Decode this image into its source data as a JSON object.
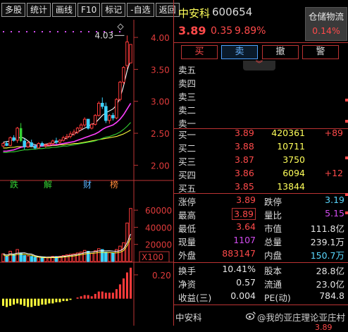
{
  "toolbar": {
    "buttons": [
      "多股",
      "统计",
      "画线",
      "F10",
      "标记",
      "-自选",
      "返回"
    ]
  },
  "stock": {
    "name": "中安科",
    "code": "600654",
    "price": "3.89",
    "change": "0.35",
    "change_pct": "9.89%",
    "sector": "仓储物流",
    "sector_pct": "0.14%"
  },
  "trade_buttons": {
    "buy": "买",
    "sell": "卖",
    "cancel": "撤",
    "alert": "警"
  },
  "collapse_icon": "double-chevron-down-icon",
  "sell_orders": [
    {
      "label": "卖五",
      "price": "",
      "volume": "",
      "change": ""
    },
    {
      "label": "卖四",
      "price": "",
      "volume": "",
      "change": ""
    },
    {
      "label": "卖三",
      "price": "",
      "volume": "",
      "change": ""
    },
    {
      "label": "卖二",
      "price": "",
      "volume": "",
      "change": ""
    },
    {
      "label": "卖一",
      "price": "",
      "volume": "",
      "change": ""
    }
  ],
  "buy_orders": [
    {
      "label": "买一",
      "price": "3.89",
      "volume": "420361",
      "change": "+89"
    },
    {
      "label": "买二",
      "price": "3.88",
      "volume": "10711",
      "change": ""
    },
    {
      "label": "买三",
      "price": "3.87",
      "volume": "3750",
      "change": ""
    },
    {
      "label": "买四",
      "price": "3.86",
      "volume": "6094",
      "change": "+12"
    },
    {
      "label": "买五",
      "price": "3.85",
      "volume": "13844",
      "change": ""
    }
  ],
  "stats1": [
    {
      "l1": "涨停",
      "v1": "3.89",
      "l2": "跌停",
      "v2": "3.19"
    },
    {
      "l1": "最高",
      "v1": "3.89",
      "l2": "量比",
      "v2": "5.15"
    },
    {
      "l1": "最低",
      "v1": "3.64",
      "l2": "市值",
      "v2": "111.8亿"
    },
    {
      "l1": "现量",
      "v1": "1107",
      "l2": "总量",
      "v2": "239.1万"
    },
    {
      "l1": "外盘",
      "v1": "883147",
      "l2": "内盘",
      "v2": "150.7万"
    }
  ],
  "stats2": [
    {
      "l1": "换手",
      "v1": "10.41%",
      "l2": "股本",
      "v2": "28.8亿"
    },
    {
      "l1": "净资",
      "v1": "0.57",
      "l2": "流通",
      "v2": "23.0亿"
    },
    {
      "l1": "收益(三)",
      "v1": "0.004",
      "l2": "PE(动)",
      "v2": "784.8"
    }
  ],
  "bottom": {
    "name": "中安科",
    "watermark": "@我的亚庄理论亚庄村",
    "price": "3.89"
  },
  "chart": {
    "price_ticks": [
      "4.00",
      "3.50",
      "3.00",
      "2.50",
      "2.00"
    ],
    "high_label": "4.03",
    "events": [
      "跌",
      "解",
      "财",
      "榜"
    ],
    "volume_ticks": [
      "60000",
      "40000",
      "20000"
    ],
    "volume_unit": "X100",
    "indicator_tick": "0.20"
  },
  "chart_data": {
    "type": "candlestick",
    "price_ylim": [
      1.85,
      4.1
    ],
    "candles": [
      [
        2.3,
        2.36,
        2.28,
        2.34
      ],
      [
        2.34,
        2.38,
        2.3,
        2.31
      ],
      [
        2.31,
        2.45,
        2.3,
        2.43
      ],
      [
        2.43,
        2.47,
        2.37,
        2.39
      ],
      [
        2.39,
        2.6,
        2.35,
        2.58
      ],
      [
        2.58,
        2.66,
        2.36,
        2.38
      ],
      [
        2.38,
        2.42,
        2.25,
        2.29
      ],
      [
        2.29,
        2.38,
        2.27,
        2.35
      ],
      [
        2.35,
        2.4,
        2.28,
        2.3
      ],
      [
        2.3,
        2.33,
        2.25,
        2.27
      ],
      [
        2.27,
        2.36,
        2.26,
        2.34
      ],
      [
        2.34,
        2.37,
        2.29,
        2.31
      ],
      [
        2.31,
        2.34,
        2.27,
        2.32
      ],
      [
        2.32,
        2.36,
        2.3,
        2.34
      ],
      [
        2.34,
        2.4,
        2.31,
        2.38
      ],
      [
        2.38,
        2.43,
        2.33,
        2.36
      ],
      [
        2.36,
        2.41,
        2.33,
        2.39
      ],
      [
        2.39,
        2.46,
        2.37,
        2.43
      ],
      [
        2.43,
        2.49,
        2.4,
        2.45
      ],
      [
        2.45,
        2.53,
        2.42,
        2.49
      ],
      [
        2.49,
        2.56,
        2.46,
        2.52
      ],
      [
        2.52,
        2.6,
        2.49,
        2.58
      ],
      [
        2.58,
        2.66,
        2.54,
        2.63
      ],
      [
        2.63,
        2.75,
        2.6,
        2.72
      ],
      [
        2.72,
        2.7,
        2.56,
        2.58
      ],
      [
        2.58,
        2.66,
        2.56,
        2.64
      ],
      [
        2.64,
        2.8,
        2.62,
        2.78
      ],
      [
        2.78,
        3.0,
        2.76,
        2.97
      ],
      [
        2.97,
        3.06,
        2.88,
        2.92
      ],
      [
        2.92,
        2.98,
        2.66,
        2.7
      ],
      [
        2.7,
        2.8,
        2.65,
        2.78
      ],
      [
        2.78,
        2.82,
        2.7,
        2.74
      ],
      [
        2.74,
        3.05,
        2.72,
        3.03
      ],
      [
        3.03,
        3.32,
        3.0,
        3.3
      ],
      [
        3.3,
        3.55,
        3.26,
        3.53
      ],
      [
        3.56,
        4.03,
        3.5,
        3.93
      ],
      [
        3.6,
        3.89,
        3.6,
        3.89
      ]
    ],
    "ma_series": [
      {
        "color": "#ffffff",
        "values": [
          2.36,
          2.37,
          2.38,
          2.4,
          2.42,
          2.44,
          2.42,
          2.38,
          2.34,
          2.32,
          2.31,
          2.32,
          2.33,
          2.34,
          2.35,
          2.36,
          2.38,
          2.4,
          2.43,
          2.46,
          2.49,
          2.52,
          2.55,
          2.58,
          2.61,
          2.64,
          2.66,
          2.72,
          2.78,
          2.82,
          2.85,
          2.88,
          2.94,
          3.05,
          3.24,
          3.48,
          3.65
        ]
      },
      {
        "color": "#ffff3c",
        "values": [
          2.27,
          2.27,
          2.28,
          2.28,
          2.29,
          2.29,
          2.29,
          2.29,
          2.29,
          2.29,
          2.29,
          2.3,
          2.3,
          2.3,
          2.31,
          2.31,
          2.32,
          2.32,
          2.33,
          2.33,
          2.34,
          2.34,
          2.35,
          2.36,
          2.37,
          2.38,
          2.39,
          2.4,
          2.41,
          2.42,
          2.43,
          2.44,
          2.45,
          2.47,
          2.49,
          2.52,
          2.55
        ]
      },
      {
        "color": "#ff40ff",
        "values": [
          2.22,
          2.22,
          2.23,
          2.24,
          2.26,
          2.28,
          2.29,
          2.3,
          2.3,
          2.3,
          2.3,
          2.3,
          2.31,
          2.31,
          2.32,
          2.32,
          2.33,
          2.34,
          2.35,
          2.36,
          2.37,
          2.39,
          2.41,
          2.43,
          2.45,
          2.47,
          2.49,
          2.52,
          2.56,
          2.59,
          2.61,
          2.63,
          2.67,
          2.72,
          2.79,
          2.88,
          2.97
        ]
      },
      {
        "color": "#34d334",
        "values": [
          2.2,
          2.2,
          2.21,
          2.21,
          2.22,
          2.23,
          2.24,
          2.24,
          2.25,
          2.25,
          2.26,
          2.26,
          2.27,
          2.27,
          2.28,
          2.28,
          2.29,
          2.3,
          2.3,
          2.31,
          2.32,
          2.33,
          2.34,
          2.35,
          2.36,
          2.37,
          2.38,
          2.4,
          2.42,
          2.44,
          2.45,
          2.47,
          2.49,
          2.52,
          2.56,
          2.61,
          2.67
        ]
      }
    ],
    "volume_ylim": [
      0,
      70000
    ],
    "volumes": [
      9000,
      6000,
      12000,
      8000,
      14000,
      10000,
      7000,
      6500,
      6000,
      5000,
      5500,
      5000,
      4800,
      5200,
      6000,
      5800,
      6200,
      7000,
      7800,
      8500,
      9000,
      10000,
      11000,
      13000,
      12000,
      9500,
      12500,
      15000,
      14000,
      11000,
      10500,
      10000,
      14000,
      18000,
      22000,
      45000,
      62000
    ],
    "indicator_ylim": [
      -0.12,
      0.3
    ],
    "indicator": [
      -0.06,
      -0.07,
      -0.06,
      -0.05,
      -0.04,
      -0.05,
      -0.06,
      -0.07,
      -0.07,
      -0.06,
      -0.06,
      -0.05,
      -0.05,
      -0.04,
      -0.04,
      -0.03,
      -0.03,
      -0.02,
      -0.02,
      -0.01,
      0.0,
      0.01,
      0.02,
      0.03,
      0.03,
      0.02,
      0.04,
      0.06,
      0.06,
      0.05,
      0.05,
      0.05,
      0.08,
      0.12,
      0.17,
      0.22,
      0.26
    ]
  }
}
